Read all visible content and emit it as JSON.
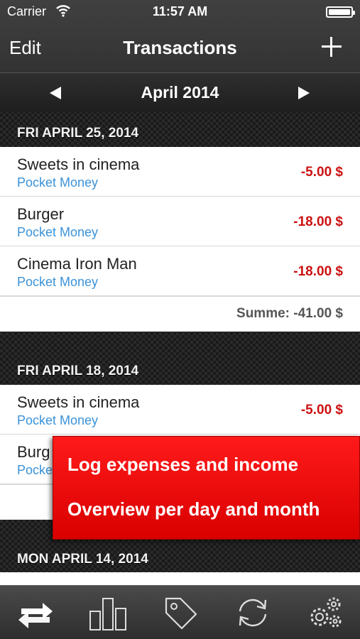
{
  "status": {
    "carrier": "Carrier",
    "time": "11:57 AM"
  },
  "nav": {
    "edit_label": "Edit",
    "title": "Transactions",
    "add_icon": "plus-icon"
  },
  "month": {
    "label": "April 2014"
  },
  "sections": [
    {
      "date": "FRI APRIL 25, 2014",
      "items": [
        {
          "title": "Sweets in cinema",
          "category": "Pocket Money",
          "amount": "-5.00 $"
        },
        {
          "title": "Burger",
          "category": "Pocket Money",
          "amount": "-18.00 $"
        },
        {
          "title": "Cinema Iron Man",
          "category": "Pocket Money",
          "amount": "-18.00 $"
        }
      ],
      "sum": "Summe: -41.00 $"
    },
    {
      "date": "FRI APRIL 18, 2014",
      "items": [
        {
          "title": "Sweets in cinema",
          "category": "Pocket Money",
          "amount": "-5.00 $"
        },
        {
          "title": "Burg",
          "category": "Pocke",
          "amount": ""
        }
      ]
    },
    {
      "date": "MON APRIL 14, 2014"
    }
  ],
  "promo": {
    "line1": "Log expenses and income",
    "line2": "Overview per day and month"
  },
  "tabs": [
    {
      "icon": "transactions-icon"
    },
    {
      "icon": "bar-chart-icon"
    },
    {
      "icon": "tag-icon"
    },
    {
      "icon": "sync-icon"
    },
    {
      "icon": "settings-icon"
    }
  ],
  "colors": {
    "amount": "#cc1111",
    "category": "#3a92d8",
    "promo": "#e60000"
  }
}
